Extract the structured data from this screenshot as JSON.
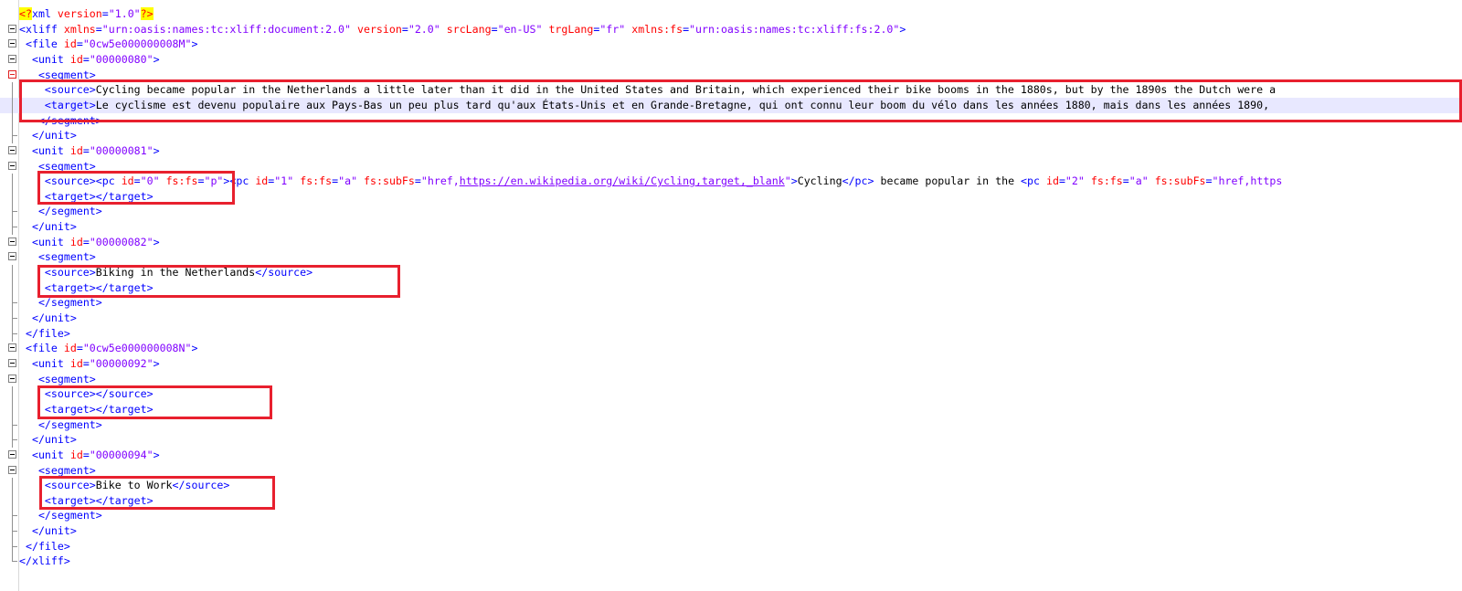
{
  "lines": [
    {
      "ind": "",
      "parts": [
        [
          "pi",
          "<?"
        ],
        [
          "t",
          "xml "
        ],
        [
          "a",
          "version"
        ],
        [
          "t",
          "="
        ],
        [
          "v",
          "\"1.0\""
        ],
        [
          "pi",
          "?>"
        ]
      ]
    },
    {
      "ind": "",
      "parts": [
        [
          "t",
          "<xliff "
        ],
        [
          "a",
          "xmlns"
        ],
        [
          "t",
          "="
        ],
        [
          "v",
          "\"urn:oasis:names:tc:xliff:document:2.0\""
        ],
        [
          "t",
          " "
        ],
        [
          "a",
          "version"
        ],
        [
          "t",
          "="
        ],
        [
          "v",
          "\"2.0\""
        ],
        [
          "t",
          " "
        ],
        [
          "a",
          "srcLang"
        ],
        [
          "t",
          "="
        ],
        [
          "v",
          "\"en-US\""
        ],
        [
          "t",
          " "
        ],
        [
          "a",
          "trgLang"
        ],
        [
          "t",
          "="
        ],
        [
          "v",
          "\"fr\""
        ],
        [
          "t",
          " "
        ],
        [
          "a",
          "xmlns:fs"
        ],
        [
          "t",
          "="
        ],
        [
          "v",
          "\"urn:oasis:names:tc:xliff:fs:2.0\""
        ],
        [
          "t",
          ">"
        ]
      ]
    },
    {
      "ind": " ",
      "parts": [
        [
          "t",
          "<file "
        ],
        [
          "a",
          "id"
        ],
        [
          "t",
          "="
        ],
        [
          "v",
          "\"0cw5e000000008M\""
        ],
        [
          "t",
          ">"
        ]
      ]
    },
    {
      "ind": "  ",
      "parts": [
        [
          "t",
          "<unit "
        ],
        [
          "a",
          "id"
        ],
        [
          "t",
          "="
        ],
        [
          "v",
          "\"00000080\""
        ],
        [
          "t",
          ">"
        ]
      ]
    },
    {
      "ind": "   ",
      "parts": [
        [
          "t",
          "<segment>"
        ]
      ]
    },
    {
      "ind": "    ",
      "parts": [
        [
          "t",
          "<source>"
        ],
        [
          "tx",
          "Cycling became popular in the Netherlands a little later than it did in the United States and Britain, which experienced their bike booms in the 1880s, but by the 1890s the Dutch were a"
        ]
      ]
    },
    {
      "ind": "    ",
      "parts": [
        [
          "t",
          "<target>"
        ],
        [
          "tx",
          "Le cyclisme est devenu populaire aux Pays-Bas un peu plus tard qu'aux États-Unis et en Grande-Bretagne, qui ont connu leur boom du vélo dans les années 1880, mais dans les années 1890,"
        ]
      ]
    },
    {
      "ind": "   ",
      "parts": [
        [
          "t",
          "</segment>"
        ]
      ]
    },
    {
      "ind": "  ",
      "parts": [
        [
          "t",
          "</unit>"
        ]
      ]
    },
    {
      "ind": "  ",
      "parts": [
        [
          "t",
          "<unit "
        ],
        [
          "a",
          "id"
        ],
        [
          "t",
          "="
        ],
        [
          "v",
          "\"00000081\""
        ],
        [
          "t",
          ">"
        ]
      ]
    },
    {
      "ind": "   ",
      "parts": [
        [
          "t",
          "<segment>"
        ]
      ]
    },
    {
      "ind": "    ",
      "parts": [
        [
          "t",
          "<source><pc "
        ],
        [
          "a",
          "id"
        ],
        [
          "t",
          "="
        ],
        [
          "v",
          "\"0\""
        ],
        [
          "t",
          " "
        ],
        [
          "a",
          "fs:fs"
        ],
        [
          "t",
          "="
        ],
        [
          "v",
          "\"p\""
        ],
        [
          "t",
          "><pc "
        ],
        [
          "a",
          "id"
        ],
        [
          "t",
          "="
        ],
        [
          "v",
          "\"1\""
        ],
        [
          "t",
          " "
        ],
        [
          "a",
          "fs:fs"
        ],
        [
          "t",
          "="
        ],
        [
          "v",
          "\"a\""
        ],
        [
          "t",
          " "
        ],
        [
          "a",
          "fs:subFs"
        ],
        [
          "t",
          "="
        ],
        [
          "v",
          "\"href,"
        ],
        [
          "u",
          "https://en.wikipedia.org/wiki/Cycling,target,_blank"
        ],
        [
          "v",
          "\""
        ],
        [
          "t",
          ">"
        ],
        [
          "tx",
          "Cycling"
        ],
        [
          "t",
          "</pc>"
        ],
        [
          "tx",
          " became popular in the "
        ],
        [
          "t",
          "<pc "
        ],
        [
          "a",
          "id"
        ],
        [
          "t",
          "="
        ],
        [
          "v",
          "\"2\""
        ],
        [
          "t",
          " "
        ],
        [
          "a",
          "fs:fs"
        ],
        [
          "t",
          "="
        ],
        [
          "v",
          "\"a\""
        ],
        [
          "t",
          " "
        ],
        [
          "a",
          "fs:subFs"
        ],
        [
          "t",
          "="
        ],
        [
          "v",
          "\"href,https"
        ]
      ]
    },
    {
      "ind": "    ",
      "parts": [
        [
          "t",
          "<target></target>"
        ]
      ]
    },
    {
      "ind": "   ",
      "parts": [
        [
          "t",
          "</segment>"
        ]
      ]
    },
    {
      "ind": "  ",
      "parts": [
        [
          "t",
          "</unit>"
        ]
      ]
    },
    {
      "ind": "  ",
      "parts": [
        [
          "t",
          "<unit "
        ],
        [
          "a",
          "id"
        ],
        [
          "t",
          "="
        ],
        [
          "v",
          "\"00000082\""
        ],
        [
          "t",
          ">"
        ]
      ]
    },
    {
      "ind": "   ",
      "parts": [
        [
          "t",
          "<segment>"
        ]
      ]
    },
    {
      "ind": "    ",
      "parts": [
        [
          "t",
          "<source>"
        ],
        [
          "tx",
          "Biking in the Netherlands"
        ],
        [
          "t",
          "</source>"
        ]
      ]
    },
    {
      "ind": "    ",
      "parts": [
        [
          "t",
          "<target></target>"
        ]
      ]
    },
    {
      "ind": "   ",
      "parts": [
        [
          "t",
          "</segment>"
        ]
      ]
    },
    {
      "ind": "  ",
      "parts": [
        [
          "t",
          "</unit>"
        ]
      ]
    },
    {
      "ind": " ",
      "parts": [
        [
          "t",
          "</file>"
        ]
      ]
    },
    {
      "ind": " ",
      "parts": [
        [
          "t",
          "<file "
        ],
        [
          "a",
          "id"
        ],
        [
          "t",
          "="
        ],
        [
          "v",
          "\"0cw5e000000008N\""
        ],
        [
          "t",
          ">"
        ]
      ]
    },
    {
      "ind": "  ",
      "parts": [
        [
          "t",
          "<unit "
        ],
        [
          "a",
          "id"
        ],
        [
          "t",
          "="
        ],
        [
          "v",
          "\"00000092\""
        ],
        [
          "t",
          ">"
        ]
      ]
    },
    {
      "ind": "   ",
      "parts": [
        [
          "t",
          "<segment>"
        ]
      ]
    },
    {
      "ind": "    ",
      "parts": [
        [
          "t",
          "<source></source>"
        ]
      ]
    },
    {
      "ind": "    ",
      "parts": [
        [
          "t",
          "<target></target>"
        ]
      ]
    },
    {
      "ind": "   ",
      "parts": [
        [
          "t",
          "</segment>"
        ]
      ]
    },
    {
      "ind": "  ",
      "parts": [
        [
          "t",
          "</unit>"
        ]
      ]
    },
    {
      "ind": "  ",
      "parts": [
        [
          "t",
          "<unit "
        ],
        [
          "a",
          "id"
        ],
        [
          "t",
          "="
        ],
        [
          "v",
          "\"00000094\""
        ],
        [
          "t",
          ">"
        ]
      ]
    },
    {
      "ind": "   ",
      "parts": [
        [
          "t",
          "<segment>"
        ]
      ]
    },
    {
      "ind": "    ",
      "parts": [
        [
          "t",
          "<source>"
        ],
        [
          "tx",
          "Bike to Work"
        ],
        [
          "t",
          "</source>"
        ]
      ]
    },
    {
      "ind": "    ",
      "parts": [
        [
          "t",
          "<target></target>"
        ]
      ]
    },
    {
      "ind": "   ",
      "parts": [
        [
          "t",
          "</segment>"
        ]
      ]
    },
    {
      "ind": "  ",
      "parts": [
        [
          "t",
          "</unit>"
        ]
      ]
    },
    {
      "ind": " ",
      "parts": [
        [
          "t",
          "</file>"
        ]
      ]
    },
    {
      "ind": "",
      "parts": [
        [
          "t",
          "</xliff>"
        ]
      ]
    }
  ],
  "gutter": [
    "",
    "fold",
    "fold",
    "fold",
    "fold-red",
    "v",
    "v",
    "v",
    "end",
    "fold",
    "fold",
    "v",
    "v",
    "end",
    "end",
    "fold",
    "fold",
    "v",
    "v",
    "end",
    "end",
    "end",
    "fold",
    "fold",
    "fold",
    "v",
    "v",
    "end",
    "end",
    "fold",
    "fold",
    "v",
    "v",
    "end",
    "end",
    "end",
    "last"
  ],
  "highlight_line": 6
}
